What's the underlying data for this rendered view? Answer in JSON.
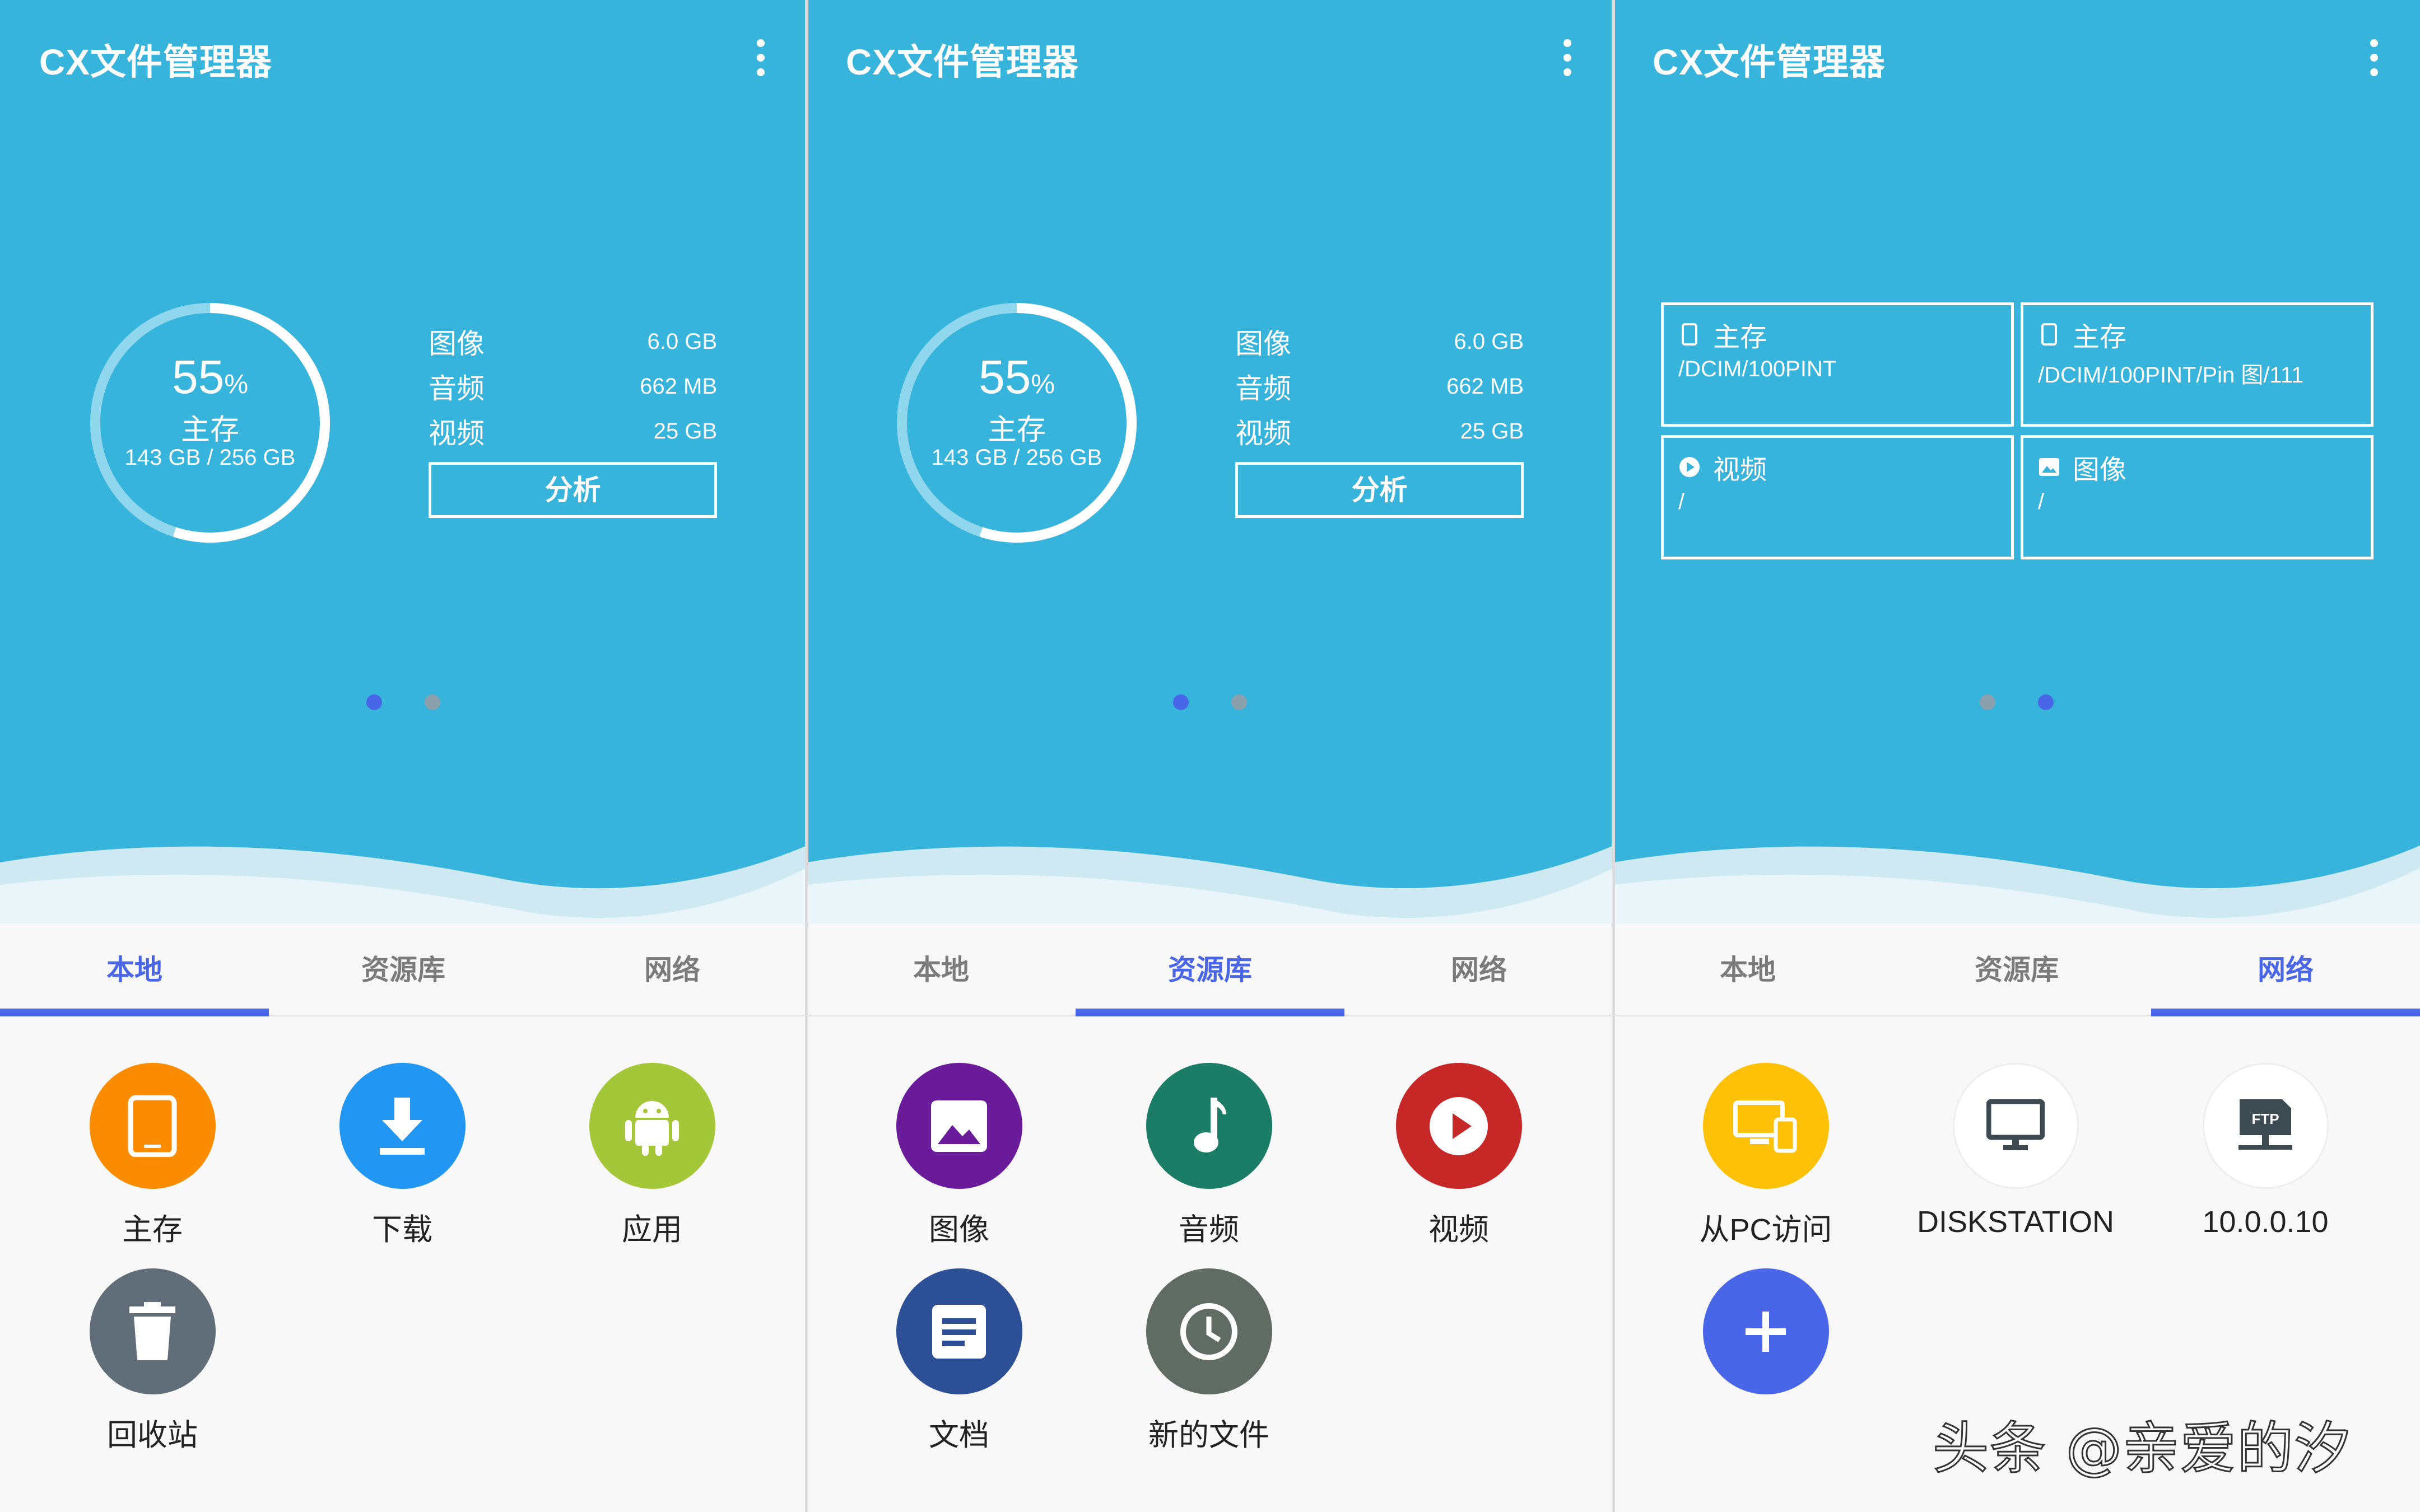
{
  "app_title": "CX文件管理器",
  "storage": {
    "percent": "55",
    "percent_sign": "%",
    "label": "主存",
    "capacity": "143 GB / 256 GB",
    "used_fraction": 0.55
  },
  "stats": [
    {
      "name": "图像",
      "value": "6.0 GB"
    },
    {
      "name": "音频",
      "value": "662 MB"
    },
    {
      "name": "视频",
      "value": "25 GB"
    }
  ],
  "analyze_label": "分析",
  "tabs": [
    "本地",
    "资源库",
    "网络"
  ],
  "shortcuts": [
    {
      "title": "主存",
      "path": "/DCIM/100PINT",
      "icon": "phone-icon"
    },
    {
      "title": "主存",
      "path": "/DCIM/100PINT/Pin 图/111",
      "icon": "phone-icon"
    },
    {
      "title": "视频",
      "path": "/",
      "icon": "play-icon"
    },
    {
      "title": "图像",
      "path": "/",
      "icon": "image-icon"
    }
  ],
  "local_items": [
    {
      "label": "主存",
      "icon": "phone-icon",
      "color": "#fb8c00"
    },
    {
      "label": "下载",
      "icon": "download-icon",
      "color": "#2196f3"
    },
    {
      "label": "应用",
      "icon": "android-icon",
      "color": "#a4c639"
    },
    {
      "label": "回收站",
      "icon": "trash-icon",
      "color": "#616d78"
    }
  ],
  "library_items": [
    {
      "label": "图像",
      "icon": "image-icon",
      "color": "#6a1b9a"
    },
    {
      "label": "音频",
      "icon": "music-note-icon",
      "color": "#1b7d66"
    },
    {
      "label": "视频",
      "icon": "play-icon",
      "color": "#c62828"
    },
    {
      "label": "文档",
      "icon": "document-icon",
      "color": "#2c4f96"
    },
    {
      "label": "新的文件",
      "icon": "clock-icon",
      "color": "#5f6b63"
    }
  ],
  "network_items": [
    {
      "label": "从PC访问",
      "icon": "pc-phone-icon",
      "color": "#ffc107"
    },
    {
      "label": "DISKSTATION",
      "icon": "monitor-icon",
      "color": "#ffffff"
    },
    {
      "label": "10.0.0.10",
      "icon": "ftp-icon",
      "color": "#ffffff"
    }
  ],
  "add_button_color": "#4a66e8",
  "watermark": "头条 @亲爱的汐",
  "colors": {
    "hero": "#36b4dc",
    "accent": "#4a66e8"
  }
}
